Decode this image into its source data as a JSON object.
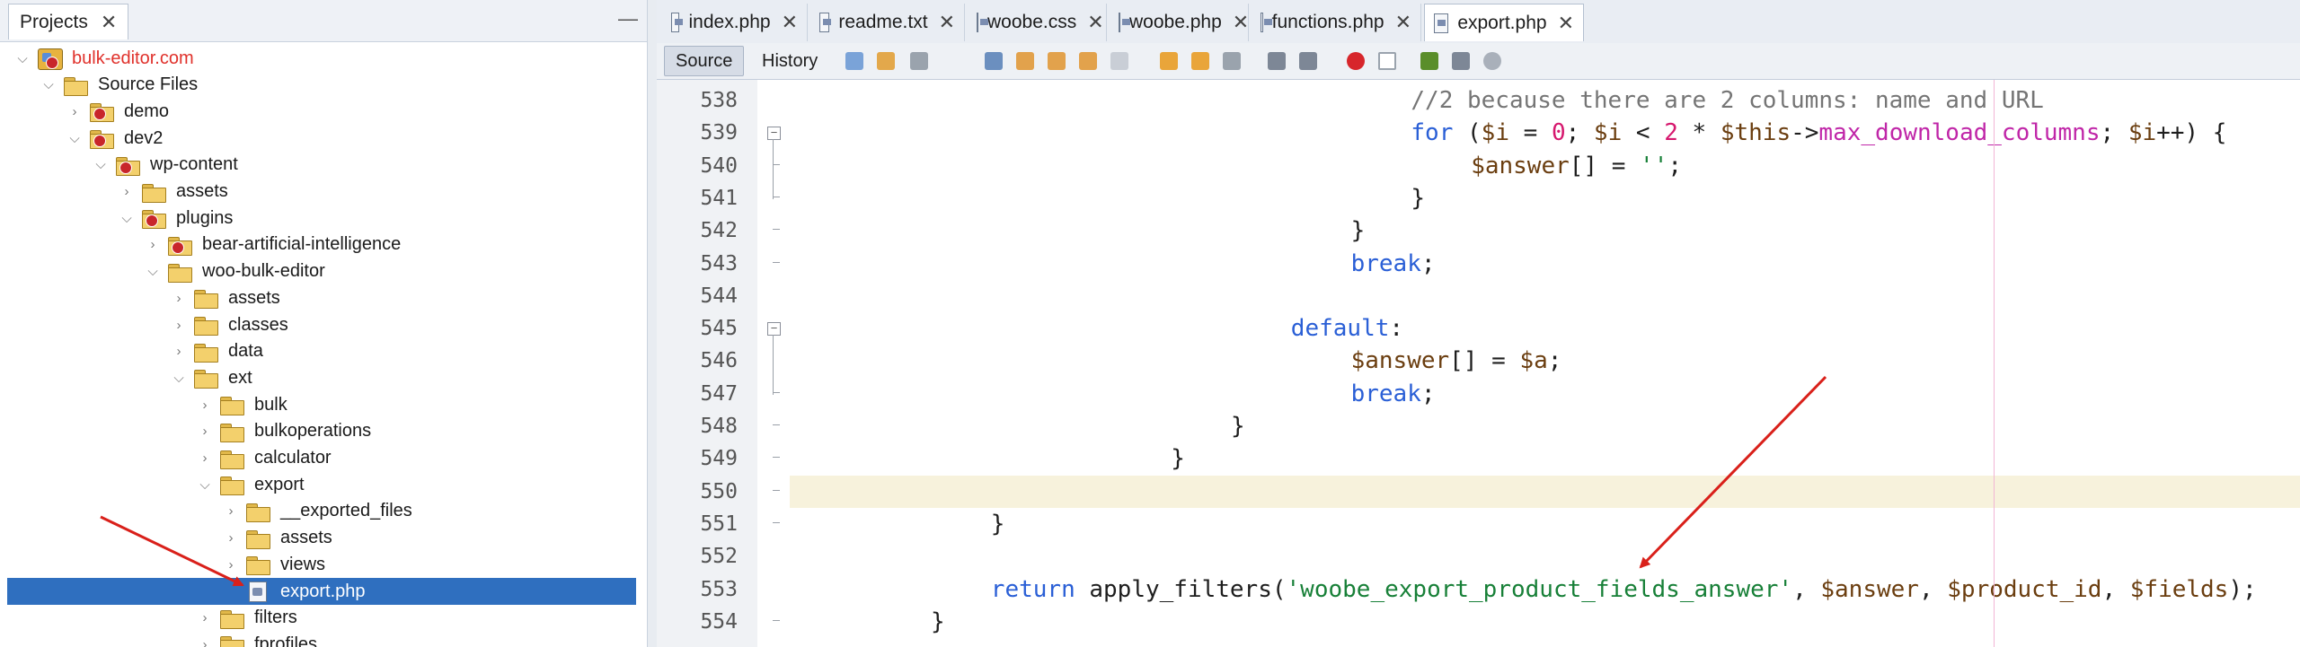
{
  "projects_panel": {
    "tab_label": "Projects",
    "minimize_label": "—",
    "tree": [
      {
        "label": "bulk-editor.com",
        "level": 0,
        "toggle": "expanded",
        "icon": "project-icon",
        "color": "#e0312b"
      },
      {
        "label": "Source Files",
        "level": 1,
        "toggle": "expanded",
        "icon": "folder-icon"
      },
      {
        "label": "demo",
        "level": 2,
        "toggle": "collapsed",
        "icon": "folder-badge-icon"
      },
      {
        "label": "dev2",
        "level": 2,
        "toggle": "expanded",
        "icon": "folder-badge-icon"
      },
      {
        "label": "wp-content",
        "level": 3,
        "toggle": "expanded",
        "icon": "folder-badge-icon"
      },
      {
        "label": "assets",
        "level": 4,
        "toggle": "collapsed",
        "icon": "folder-icon"
      },
      {
        "label": "plugins",
        "level": 4,
        "toggle": "expanded",
        "icon": "folder-badge-icon"
      },
      {
        "label": "bear-artificial-intelligence",
        "level": 5,
        "toggle": "collapsed",
        "icon": "folder-badge-icon"
      },
      {
        "label": "woo-bulk-editor",
        "level": 5,
        "toggle": "expanded",
        "icon": "folder-icon"
      },
      {
        "label": "assets",
        "level": 6,
        "toggle": "collapsed",
        "icon": "folder-icon"
      },
      {
        "label": "classes",
        "level": 6,
        "toggle": "collapsed",
        "icon": "folder-icon"
      },
      {
        "label": "data",
        "level": 6,
        "toggle": "collapsed",
        "icon": "folder-icon"
      },
      {
        "label": "ext",
        "level": 6,
        "toggle": "expanded",
        "icon": "folder-icon"
      },
      {
        "label": "bulk",
        "level": 7,
        "toggle": "collapsed",
        "icon": "folder-icon"
      },
      {
        "label": "bulkoperations",
        "level": 7,
        "toggle": "collapsed",
        "icon": "folder-icon"
      },
      {
        "label": "calculator",
        "level": 7,
        "toggle": "collapsed",
        "icon": "folder-icon"
      },
      {
        "label": "export",
        "level": 7,
        "toggle": "expanded",
        "icon": "folder-icon"
      },
      {
        "label": "__exported_files",
        "level": 8,
        "toggle": "collapsed",
        "icon": "folder-icon"
      },
      {
        "label": "assets",
        "level": 8,
        "toggle": "collapsed",
        "icon": "folder-icon"
      },
      {
        "label": "views",
        "level": 8,
        "toggle": "collapsed",
        "icon": "folder-icon"
      },
      {
        "label": "export.php",
        "level": 8,
        "toggle": "none",
        "icon": "php-file-icon",
        "selected": true
      },
      {
        "label": "filters",
        "level": 7,
        "toggle": "collapsed",
        "icon": "folder-icon"
      },
      {
        "label": "fprofiles",
        "level": 7,
        "toggle": "collapsed",
        "icon": "folder-icon"
      }
    ]
  },
  "editor": {
    "tabs": [
      {
        "label": "index.php",
        "active": false
      },
      {
        "label": "readme.txt",
        "active": false
      },
      {
        "label": "woobe.css",
        "active": false
      },
      {
        "label": "woobe.php",
        "active": false
      },
      {
        "label": "functions.php",
        "active": false
      },
      {
        "label": "export.php",
        "active": true
      }
    ],
    "toolbar": {
      "source_label": "Source",
      "history_label": "History"
    },
    "highlight_line": "550",
    "lines": [
      {
        "num": "538",
        "indent": 21,
        "tokens": [
          {
            "t": "//2 because there are 2 columns: name and URL",
            "c": "cm"
          }
        ]
      },
      {
        "num": "539",
        "indent": 21,
        "tokens": [
          {
            "t": "for",
            "c": "kw"
          },
          {
            "t": " (",
            "c": "op"
          },
          {
            "t": "$i",
            "c": "var"
          },
          {
            "t": " = ",
            "c": "op"
          },
          {
            "t": "0",
            "c": "num"
          },
          {
            "t": "; ",
            "c": "op"
          },
          {
            "t": "$i",
            "c": "var"
          },
          {
            "t": " < ",
            "c": "op"
          },
          {
            "t": "2",
            "c": "num"
          },
          {
            "t": " * ",
            "c": "op"
          },
          {
            "t": "$this",
            "c": "var"
          },
          {
            "t": "->",
            "c": "op"
          },
          {
            "t": "max_download_columns",
            "c": "fn"
          },
          {
            "t": "; ",
            "c": "op"
          },
          {
            "t": "$i",
            "c": "var"
          },
          {
            "t": "++) {",
            "c": "op"
          }
        ]
      },
      {
        "num": "540",
        "indent": 23,
        "tokens": [
          {
            "t": "$answer",
            "c": "var"
          },
          {
            "t": "[] = ",
            "c": "op"
          },
          {
            "t": "''",
            "c": "str"
          },
          {
            "t": ";",
            "c": "op"
          }
        ]
      },
      {
        "num": "541",
        "indent": 21,
        "tokens": [
          {
            "t": "}",
            "c": "op"
          }
        ]
      },
      {
        "num": "542",
        "indent": 19,
        "tokens": [
          {
            "t": "}",
            "c": "op"
          }
        ]
      },
      {
        "num": "543",
        "indent": 19,
        "tokens": [
          {
            "t": "break",
            "c": "kw"
          },
          {
            "t": ";",
            "c": "op"
          }
        ]
      },
      {
        "num": "544",
        "indent": 0,
        "tokens": []
      },
      {
        "num": "545",
        "indent": 17,
        "tokens": [
          {
            "t": "default",
            "c": "kw"
          },
          {
            "t": ":",
            "c": "op"
          }
        ]
      },
      {
        "num": "546",
        "indent": 19,
        "tokens": [
          {
            "t": "$answer",
            "c": "var"
          },
          {
            "t": "[] = ",
            "c": "op"
          },
          {
            "t": "$a",
            "c": "var"
          },
          {
            "t": ";",
            "c": "op"
          }
        ]
      },
      {
        "num": "547",
        "indent": 19,
        "tokens": [
          {
            "t": "break",
            "c": "kw"
          },
          {
            "t": ";",
            "c": "op"
          }
        ]
      },
      {
        "num": "548",
        "indent": 15,
        "tokens": [
          {
            "t": "}",
            "c": "op"
          }
        ]
      },
      {
        "num": "549",
        "indent": 13,
        "tokens": [
          {
            "t": "}",
            "c": "op"
          }
        ]
      },
      {
        "num": "550",
        "indent": 9,
        "tokens": [
          {
            "t": "}",
            "c": "op"
          }
        ]
      },
      {
        "num": "551",
        "indent": 7,
        "tokens": [
          {
            "t": "}",
            "c": "op"
          }
        ]
      },
      {
        "num": "552",
        "indent": 0,
        "tokens": []
      },
      {
        "num": "553",
        "indent": 7,
        "tokens": [
          {
            "t": "return",
            "c": "kw"
          },
          {
            "t": " apply_filters(",
            "c": "op"
          },
          {
            "t": "'woobe_export_product_fields_answer'",
            "c": "str"
          },
          {
            "t": ", ",
            "c": "op"
          },
          {
            "t": "$answer",
            "c": "var"
          },
          {
            "t": ", ",
            "c": "op"
          },
          {
            "t": "$product_id",
            "c": "var"
          },
          {
            "t": ", ",
            "c": "op"
          },
          {
            "t": "$fields",
            "c": "var"
          },
          {
            "t": ");",
            "c": "op"
          }
        ]
      },
      {
        "num": "554",
        "indent": 5,
        "tokens": [
          {
            "t": "}",
            "c": "op"
          }
        ]
      }
    ]
  },
  "colors": {
    "selection": "#2f6fbf",
    "keyword": "#2a5fd6",
    "variable": "#6b3e10",
    "number": "#d6186e",
    "string": "#188038",
    "property": "#c026a8",
    "comment": "#757575",
    "annotation_arrow": "#d9201a",
    "current_line": "#f7f2dc"
  }
}
